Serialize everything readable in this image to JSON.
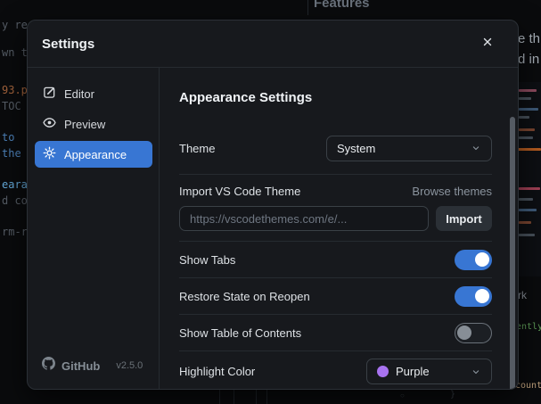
{
  "dialog": {
    "title": "Settings",
    "sidebar": {
      "items": [
        {
          "label": "Editor"
        },
        {
          "label": "Preview"
        },
        {
          "label": "Appearance"
        }
      ],
      "active": "Appearance",
      "footer": {
        "brand": "GitHub",
        "version": "v2.5.0"
      }
    },
    "content": {
      "heading": "Appearance Settings",
      "theme_label": "Theme",
      "theme_value": "System",
      "import_label": "Import VS Code Theme",
      "browse_link": "Browse themes",
      "import_placeholder": "https://vscodethemes.com/e/...",
      "import_button": "Import",
      "toggles": [
        {
          "label": "Show Tabs",
          "on": true
        },
        {
          "label": "Restore State on Reopen",
          "on": true
        },
        {
          "label": "Show Table of Contents",
          "on": false
        }
      ],
      "highlight_label": "Highlight Color",
      "highlight_value": "Purple",
      "highlight_swatch": "#a873f0"
    }
  },
  "background": {
    "features_heading": "Features",
    "left_code": [
      "y re",
      "wn t",
      "93.p",
      "TOC",
      "to",
      "the",
      "eara",
      "d co",
      "rm-r"
    ],
    "right_text": {
      "line1": "e th",
      "line2": "d in",
      "word": "rk",
      "green": "ently",
      "count": "count]"
    },
    "glyphs": {
      "circle": "○",
      "brace": "}"
    }
  },
  "colors": {
    "accent_blue": "#3876d3",
    "toggle_on": "#3876d3",
    "purple": "#a873f0"
  }
}
